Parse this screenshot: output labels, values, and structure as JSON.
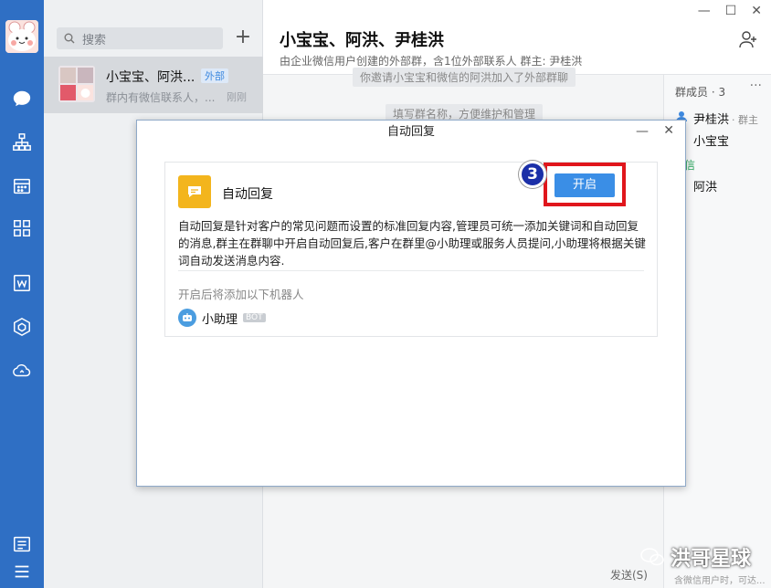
{
  "sidebar": {
    "icons": [
      "chat-icon",
      "contacts-icon",
      "calendar-icon",
      "apps-icon",
      "docs-icon",
      "workbench-icon",
      "cloud-icon",
      "settings-icon",
      "menu-icon"
    ]
  },
  "chat_list": {
    "search_placeholder": "搜索",
    "add_label": "+",
    "conversation": {
      "name": "小宝宝、阿洪...",
      "tag": "外部",
      "preview": "群内有微信联系人，...",
      "time": "刚刚"
    }
  },
  "chat": {
    "title": "小宝宝、阿洪、尹桂洪",
    "subtitle": "由企业微信用户创建的外部群，含1位外部联系人 群主: 尹桂洪",
    "system_msg_1": "你邀请小宝宝和微信的阿洪加入了外部群聊",
    "system_msg_2": "填写群名称，方便维护和管理",
    "send_label": "发送(S)",
    "hint": "含微信用户时，可达..."
  },
  "members": {
    "title": "群成员 · 3",
    "more": "···",
    "owner_name": "尹桂洪",
    "owner_badge": "· 群主",
    "member_1": "小宝宝",
    "wechat_section": "信",
    "member_2": "阿洪"
  },
  "window": {
    "minimize": "—",
    "maximize": "☐",
    "close": "✕"
  },
  "dialog": {
    "title": "自动回复",
    "minimize": "—",
    "close": "✕",
    "app_name": "自动回复",
    "description": "自动回复是针对客户的常见问题而设置的标准回复内容,管理员可统一添加关键词和自动回复的消息,群主在群聊中开启自动回复后,客户在群里@小助理或服务人员提问,小助理将根据关键词自动发送消息内容.",
    "robot_label": "开启后将添加以下机器人",
    "bot_name": "小助理",
    "bot_tag": "BOT",
    "enable_button": "开启",
    "step_number": "3"
  },
  "watermark": {
    "text": "洪哥星球"
  },
  "colors": {
    "rail": "#2f6fc4",
    "primary_button": "#3a8ee6",
    "highlight": "#e0161c",
    "app_icon": "#f3b51d"
  }
}
